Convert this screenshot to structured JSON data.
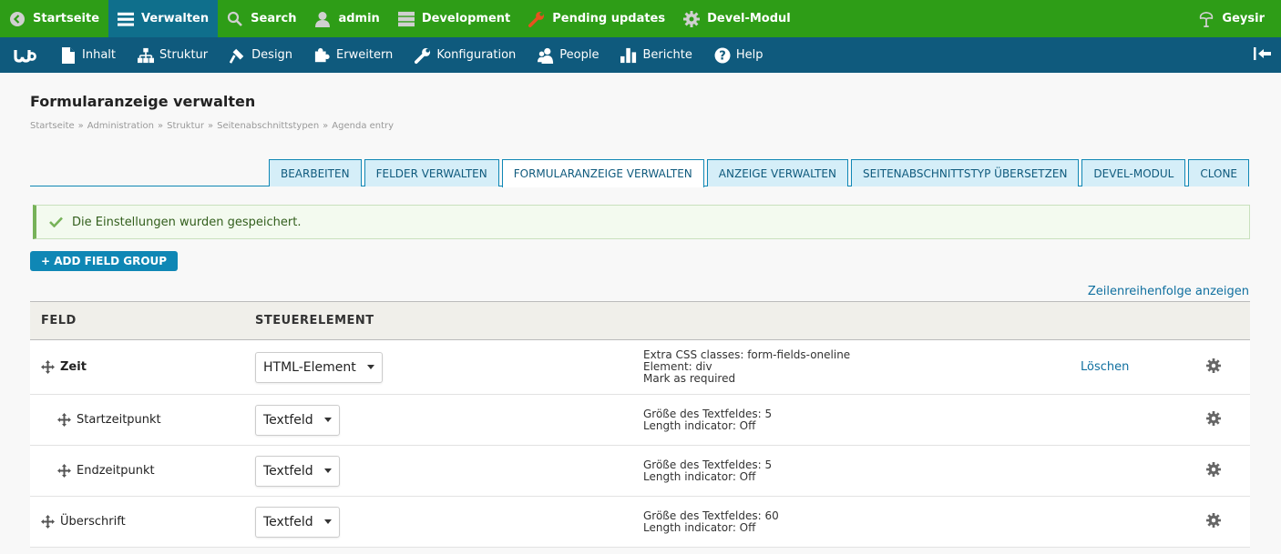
{
  "toolbar_top": {
    "items": [
      {
        "label": "Startseite",
        "icon": "back-icon"
      },
      {
        "label": "Verwalten",
        "icon": "menu-icon"
      },
      {
        "label": "Search",
        "icon": "search-icon"
      },
      {
        "label": "admin",
        "icon": "user-icon"
      },
      {
        "label": "Development",
        "icon": "server-icon"
      },
      {
        "label": "Pending updates",
        "icon": "wrench-icon"
      },
      {
        "label": "Devel-Modul",
        "icon": "gear-icon"
      }
    ],
    "right_label": "Geysir",
    "right_icon": "geysir-icon"
  },
  "toolbar_admin": {
    "items": [
      {
        "label": "Inhalt",
        "icon": "file-icon"
      },
      {
        "label": "Struktur",
        "icon": "sitemap-icon"
      },
      {
        "label": "Design",
        "icon": "paint-icon"
      },
      {
        "label": "Erweitern",
        "icon": "puzzle-icon"
      },
      {
        "label": "Konfiguration",
        "icon": "wrench-icon"
      },
      {
        "label": "People",
        "icon": "people-icon"
      },
      {
        "label": "Berichte",
        "icon": "chart-icon"
      },
      {
        "label": "Help",
        "icon": "help-icon"
      }
    ]
  },
  "page": {
    "title": "Formularanzeige verwalten",
    "breadcrumb": [
      "Startseite",
      "Administration",
      "Struktur",
      "Seitenabschnittstypen",
      "Agenda entry"
    ],
    "breadcrumb_separator": "»"
  },
  "tabs": [
    {
      "label": "BEARBEITEN",
      "active": false
    },
    {
      "label": "FELDER VERWALTEN",
      "active": false
    },
    {
      "label": "FORMULARANZEIGE VERWALTEN",
      "active": true
    },
    {
      "label": "ANZEIGE VERWALTEN",
      "active": false
    },
    {
      "label": "SEITENABSCHNITTSTYP ÜBERSETZEN",
      "active": false
    },
    {
      "label": "DEVEL-MODUL",
      "active": false
    },
    {
      "label": "CLONE",
      "active": false
    }
  ],
  "status_message": "Die Einstellungen wurden gespeichert.",
  "add_field_group_label": "+ ADD FIELD GROUP",
  "row_weights_link": "Zeilenreihenfolge anzeigen",
  "table": {
    "headers": {
      "field": "FELD",
      "widget": "STEUERELEMENT"
    },
    "rows": [
      {
        "name": "Zeit",
        "widget": "HTML-Element",
        "summary": [
          "Extra CSS classes: form-fields-oneline",
          "Element: div",
          "Mark as required"
        ],
        "delete": "Löschen"
      },
      {
        "name": "Startzeitpunkt",
        "widget": "Textfeld",
        "summary": [
          "Größe des Textfeldes: 5",
          "Length indicator: Off"
        ]
      },
      {
        "name": "Endzeitpunkt",
        "widget": "Textfeld",
        "summary": [
          "Größe des Textfeldes: 5",
          "Length indicator: Off"
        ]
      },
      {
        "name": "Überschrift",
        "widget": "Textfeld",
        "summary": [
          "Größe des Textfeldes: 60",
          "Length indicator: Off"
        ]
      }
    ]
  },
  "colors": {
    "toolbar_green": "#2e9d17",
    "toolbar_blue": "#0f5a7d",
    "accent": "#0f87b5",
    "success_border": "#77b259"
  }
}
